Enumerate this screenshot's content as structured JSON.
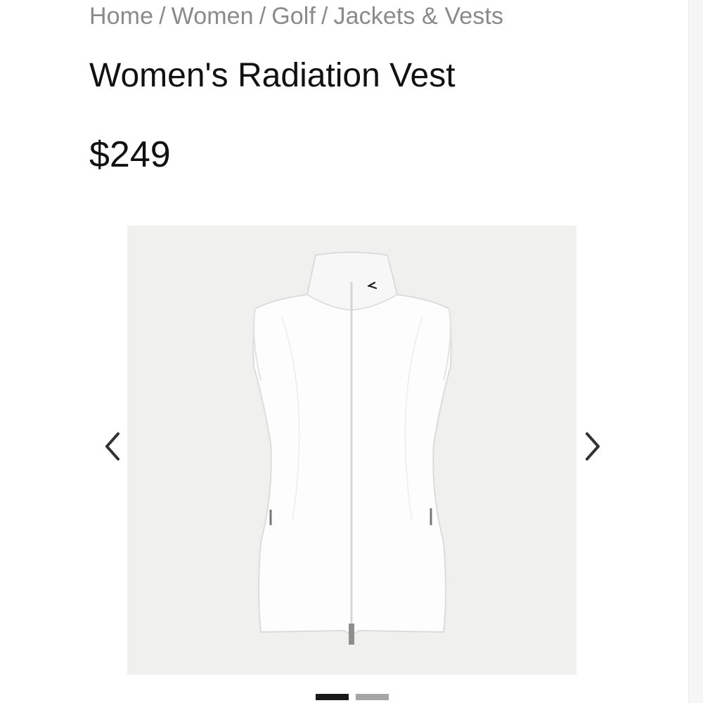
{
  "breadcrumb": {
    "items": [
      "Home",
      "Women",
      "Golf",
      "Jackets & Vests"
    ],
    "separator": "/"
  },
  "product": {
    "title": "Women's Radiation Vest",
    "price": "$249",
    "image": {
      "background": "#f0f1ef",
      "garment_color": "#fdfdfd"
    }
  },
  "gallery": {
    "prev_icon": "chevron-left-icon",
    "next_icon": "chevron-right-icon",
    "slide_count": 2,
    "active_slide": 1
  },
  "colors": {
    "text": "#111111",
    "breadcrumb": "#8a8a8a",
    "dot_active": "#1a1a1a",
    "dot_inactive": "#a6a6a6"
  }
}
